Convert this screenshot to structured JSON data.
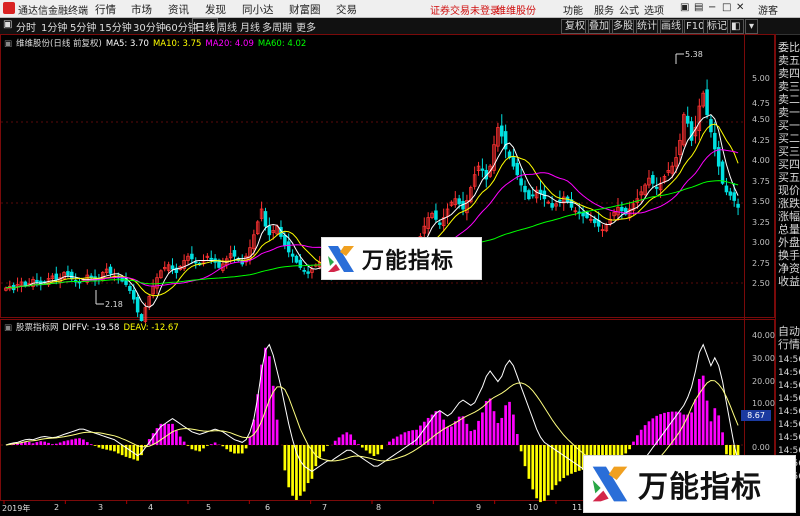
{
  "app": {
    "title": "通达信金融终端"
  },
  "menu": [
    "行情",
    "市场",
    "资讯",
    "发现",
    "同小达",
    "财富圈",
    "交易"
  ],
  "notice": "证券交易未登录",
  "stock_name_top": "维维股份",
  "right_menu": [
    "功能",
    "服务",
    "公式",
    "选项"
  ],
  "window_controls": [
    "游客"
  ],
  "periods": [
    "分时",
    "1分钟",
    "5分钟",
    "15分钟",
    "30分钟",
    "60分钟",
    "日线",
    "周线",
    "月线",
    "多周期",
    "更多"
  ],
  "active_period": "日线",
  "toolbar_right": [
    "复权",
    "叠加",
    "多股",
    "统计",
    "画线",
    "F10",
    "标记"
  ],
  "legend": {
    "title": "维维股份(日线 前复权)",
    "ma5": "MA5: 3.70",
    "ma10": "MA10: 3.75",
    "ma20": "MA20: 4.09",
    "ma60": "MA60: 4.02"
  },
  "indicator_legend": {
    "title": "股票指标网",
    "diff": "DIFFV: -19.58",
    "dea": "DEAV: -12.67"
  },
  "right_panel": [
    "委比",
    "卖五",
    "卖四",
    "卖三",
    "卖二",
    "卖一",
    "买一",
    "买二",
    "买三",
    "买四",
    "买五",
    "现价",
    "涨跌",
    "涨幅",
    "总量",
    "外盘",
    "换手",
    "净资",
    "收益",
    "自动",
    "行情",
    "14:56",
    "14:56",
    "14:56",
    "14:56",
    "14:56",
    "14:56",
    "14:56",
    "14:56",
    "14:56",
    "14:56"
  ],
  "price_axis": [
    "5.00",
    "4.75",
    "4.50",
    "4.25",
    "4.00",
    "3.75",
    "3.50",
    "3.25",
    "3.00",
    "2.75",
    "2.50"
  ],
  "indicator_axis": [
    "40.00",
    "30.00",
    "20.00",
    "10.00",
    "0.00"
  ],
  "indicator_selected": "8.67",
  "x_labels": [
    "2019年",
    "2",
    "3",
    "4",
    "5",
    "6",
    "7",
    "8",
    "9",
    "10",
    "11",
    "12"
  ],
  "annotations": {
    "high": "5.38",
    "low": "2.18"
  },
  "watermark": "万能指标",
  "colors": {
    "up": "#ff3232",
    "down": "#00e0e0",
    "ma5": "#ffffff",
    "ma10": "#ffff00",
    "ma20": "#ff00ff",
    "ma60": "#00ff00",
    "bar_pos": "#ff00ff",
    "bar_neg": "#ffff00"
  },
  "chart_data": {
    "type": "candlestick",
    "close": [
      2.68,
      2.7,
      2.66,
      2.72,
      2.75,
      2.7,
      2.73,
      2.78,
      2.75,
      2.72,
      2.74,
      2.79,
      2.82,
      2.78,
      2.8,
      2.86,
      2.83,
      2.79,
      2.75,
      2.74,
      2.78,
      2.83,
      2.8,
      2.76,
      2.79,
      2.86,
      2.9,
      2.85,
      2.82,
      2.8,
      2.76,
      2.72,
      2.65,
      2.55,
      2.4,
      2.3,
      2.45,
      2.58,
      2.7,
      2.8,
      2.88,
      2.92,
      2.95,
      2.9,
      2.86,
      2.93,
      3.0,
      3.05,
      3.02,
      2.98,
      2.95,
      3.0,
      3.05,
      3.02,
      2.98,
      2.92,
      2.96,
      3.02,
      3.08,
      3.05,
      3.0,
      2.96,
      3.05,
      3.15,
      3.3,
      3.45,
      3.6,
      3.4,
      3.3,
      3.35,
      3.4,
      3.28,
      3.18,
      3.1,
      3.05,
      2.98,
      2.92,
      2.88,
      2.85,
      2.9,
      2.95,
      2.98,
      2.92,
      2.88,
      2.84,
      2.9,
      2.96,
      2.99,
      2.94,
      2.9,
      2.92,
      2.96,
      2.98,
      2.94,
      2.9,
      2.92,
      2.94,
      2.96,
      2.98,
      3.0,
      3.02,
      2.98,
      2.96,
      3.0,
      3.05,
      3.1,
      3.18,
      3.28,
      3.4,
      3.5,
      3.55,
      3.48,
      3.42,
      3.5,
      3.6,
      3.68,
      3.72,
      3.66,
      3.6,
      3.7,
      3.85,
      4.0,
      4.1,
      4.05,
      3.95,
      4.1,
      4.35,
      4.55,
      4.45,
      4.3,
      4.2,
      4.1,
      4.0,
      3.88,
      3.8,
      3.72,
      3.76,
      3.82,
      3.78,
      3.72,
      3.68,
      3.62,
      3.66,
      3.7,
      3.74,
      3.68,
      3.62,
      3.58,
      3.55,
      3.52,
      3.5,
      3.48,
      3.44,
      3.4,
      3.36,
      3.42,
      3.48,
      3.56,
      3.62,
      3.58,
      3.54,
      3.6,
      3.66,
      3.72,
      3.8,
      3.88,
      3.96,
      3.9,
      3.84,
      3.9,
      3.98,
      4.05,
      4.1,
      4.2,
      4.4,
      4.7,
      4.6,
      4.4,
      4.55,
      4.8,
      4.95,
      4.7,
      4.5,
      4.3,
      4.1,
      3.9,
      3.8,
      3.76,
      3.7,
      3.62
    ],
    "ylim": [
      2.4,
      5.5
    ],
    "indicator": {
      "diff": [
        0,
        0.5,
        0.8,
        1,
        1.5,
        2,
        2.2,
        2,
        2.5,
        3,
        3.2,
        3,
        2.8,
        3,
        3.5,
        4,
        4.5,
        5,
        5.5,
        6,
        6,
        5.5,
        5,
        4.5,
        4,
        3.5,
        3,
        2.5,
        2,
        1,
        0,
        -1,
        -2,
        -3,
        -4,
        -3,
        -1,
        1,
        3,
        5,
        7,
        8,
        9,
        10,
        9,
        8,
        7,
        6,
        5,
        4.5,
        4,
        4.5,
        5,
        5.5,
        6,
        5.5,
        5,
        4,
        3,
        2,
        1.5,
        1,
        2,
        5,
        10,
        18,
        28,
        36,
        38,
        34,
        28,
        22,
        15,
        8,
        2,
        -3,
        -6,
        -8,
        -9,
        -10,
        -9,
        -8,
        -7,
        -6,
        -6,
        -5,
        -4,
        -3,
        -2,
        -2,
        -3,
        -4,
        -5,
        -6,
        -7,
        -8,
        -8,
        -7,
        -6,
        -5,
        -4,
        -3,
        -2,
        -1,
        0,
        1,
        2,
        4,
        6,
        8,
        10,
        12,
        13,
        12,
        11,
        12,
        14,
        16,
        17,
        16,
        15,
        16,
        19,
        22,
        26,
        28,
        26,
        24,
        26,
        30,
        32,
        30,
        26,
        22,
        18,
        14,
        10,
        6,
        3,
        1,
        0,
        -1,
        -2,
        -3,
        -4,
        -5,
        -6,
        -7,
        -8,
        -9,
        -10,
        -11,
        -12,
        -13,
        -13,
        -14,
        -15,
        -16,
        -16,
        -15,
        -14,
        -13,
        -11,
        -9,
        -7,
        -5,
        -3,
        -1,
        1,
        3,
        5,
        7,
        9,
        11,
        13,
        15,
        18,
        22,
        28,
        35,
        38,
        34,
        30,
        33,
        30,
        24,
        16,
        8,
        0,
        -6,
        -12,
        -16,
        -19
      ],
      "dea": [
        0,
        0.2,
        0.4,
        0.6,
        0.9,
        1.2,
        1.5,
        1.6,
        1.8,
        2.1,
        2.4,
        2.5,
        2.6,
        2.7,
        2.9,
        3.1,
        3.4,
        3.7,
        4,
        4.4,
        4.7,
        4.8,
        4.8,
        4.7,
        4.6,
        4.4,
        4.1,
        3.8,
        3.5,
        3,
        2.4,
        1.8,
        1.1,
        0.4,
        -0.3,
        -0.6,
        -0.7,
        -0.4,
        0.2,
        1,
        2,
        3,
        4,
        5,
        5.6,
        6,
        6.2,
        6.2,
        6,
        5.8,
        5.5,
        5.3,
        5.2,
        5.3,
        5.4,
        5.4,
        5.3,
        5,
        4.6,
        4,
        3.5,
        3,
        2.8,
        3,
        4,
        6,
        9,
        13,
        17,
        20,
        22,
        22,
        21,
        18,
        14,
        10,
        6,
        3,
        0,
        -2,
        -4,
        -5,
        -5.5,
        -5.8,
        -6,
        -6,
        -5.8,
        -5.5,
        -5,
        -4.5,
        -4.2,
        -4.2,
        -4.4,
        -4.7,
        -5,
        -5.4,
        -5.8,
        -6,
        -6,
        -5.8,
        -5.5,
        -5,
        -4.5,
        -4,
        -3.3,
        -2.5,
        -1.6,
        -0.6,
        0.5,
        1.6,
        2.8,
        4,
        5,
        6,
        6.8,
        7.6,
        8.4,
        9.3,
        10.2,
        11,
        11.7,
        12.4,
        13.3,
        14.3,
        15.6,
        17,
        18,
        18.8,
        19.6,
        20.6,
        21.8,
        22.8,
        23.4,
        23.5,
        23,
        22,
        20.5,
        18.6,
        16.5,
        14.2,
        11.9,
        9.6,
        7.5,
        5.6,
        3.8,
        2.2,
        0.8,
        -0.6,
        -1.9,
        -3.1,
        -4.3,
        -5.4,
        -6.5,
        -7.5,
        -8.4,
        -9.3,
        -10.1,
        -10.8,
        -11.4,
        -11.8,
        -12,
        -12,
        -11.8,
        -11.3,
        -10.6,
        -9.7,
        -8.6,
        -7.3,
        -5.9,
        -4.3,
        -2.6,
        -0.8,
        1.1,
        3.1,
        5.3,
        7.8,
        10.8,
        14.3,
        17.2,
        19.4,
        21.6,
        23.5,
        24.4,
        24.3,
        23,
        21,
        18.2,
        14.8,
        11,
        7.4,
        4,
        -12.67
      ]
    }
  }
}
